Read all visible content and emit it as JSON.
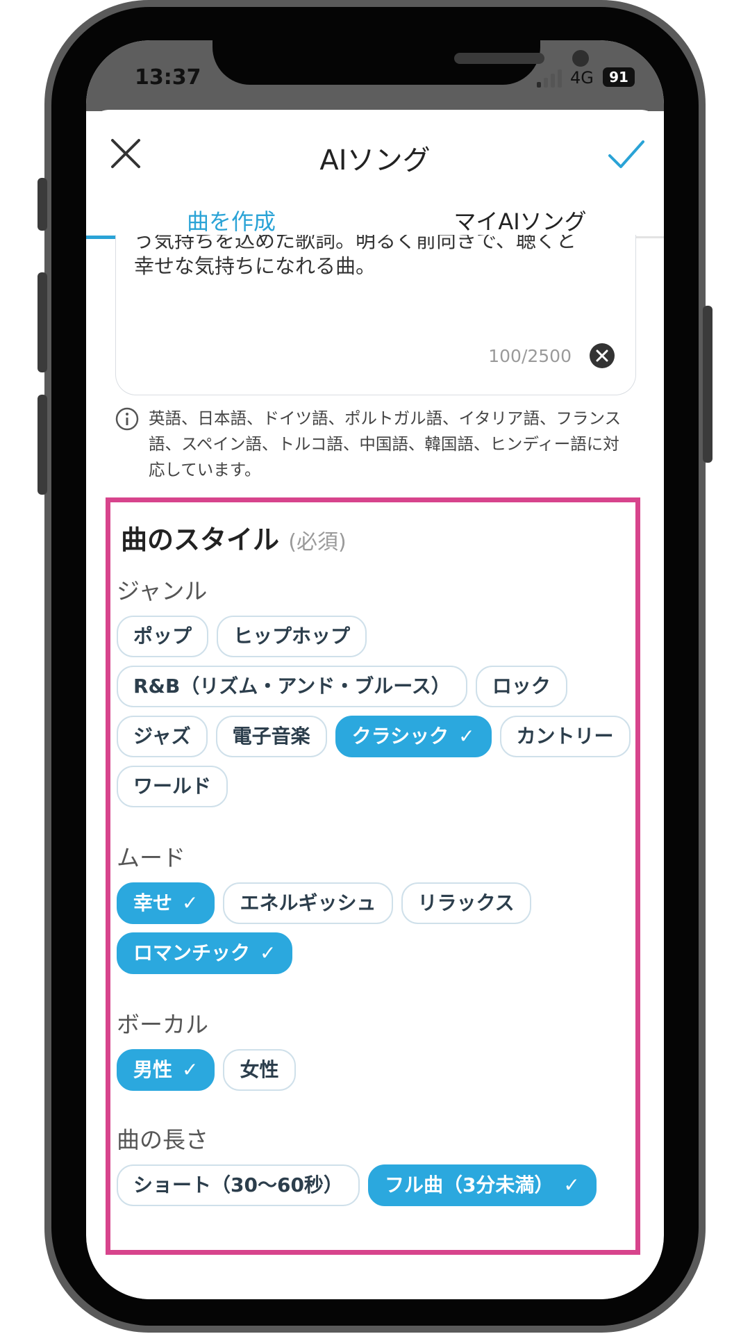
{
  "status": {
    "time": "13:37",
    "network": "4G",
    "battery": "91"
  },
  "header": {
    "title": "AIソング"
  },
  "tabs": [
    {
      "label": "曲を作成",
      "active": true
    },
    {
      "label": "マイAIソング",
      "active": false
    }
  ],
  "lyrics": {
    "text_line1": "う気持ちを込めた歌詞。明るく前向きで、聴くと",
    "text_line2": "幸せな気持ちになれる曲。",
    "counter": "100/2500"
  },
  "info": "英語、日本語、ドイツ語、ポルトガル語、イタリア語、フランス語、スペイン語、トルコ語、中国語、韓国語、ヒンディー語に対応しています。",
  "style": {
    "title": "曲のスタイル",
    "required": "(必須)",
    "genre": {
      "label": "ジャンル",
      "options": [
        {
          "label": "ポップ",
          "selected": false
        },
        {
          "label": "ヒップホップ",
          "selected": false
        },
        {
          "label": "R&B（リズム・アンド・ブルース）",
          "selected": false
        },
        {
          "label": "ロック",
          "selected": false
        },
        {
          "label": "ジャズ",
          "selected": false
        },
        {
          "label": "電子音楽",
          "selected": false
        },
        {
          "label": "クラシック",
          "selected": true
        },
        {
          "label": "カントリー",
          "selected": false
        },
        {
          "label": "ワールド",
          "selected": false
        }
      ]
    },
    "mood": {
      "label": "ムード",
      "options": [
        {
          "label": "幸せ",
          "selected": true
        },
        {
          "label": "エネルギッシュ",
          "selected": false
        },
        {
          "label": "リラックス",
          "selected": false
        },
        {
          "label": "ロマンチック",
          "selected": true
        }
      ]
    },
    "vocal": {
      "label": "ボーカル",
      "options": [
        {
          "label": "男性",
          "selected": true
        },
        {
          "label": "女性",
          "selected": false
        }
      ]
    },
    "length": {
      "label": "曲の長さ",
      "options": [
        {
          "label": "ショート（30〜60秒）",
          "selected": false
        },
        {
          "label": "フル曲（3分未満）",
          "selected": true
        }
      ]
    }
  },
  "colors": {
    "accent": "#2ba8de",
    "highlight_border": "#d7448c"
  },
  "icons": {
    "close": "close-icon",
    "done": "checkmark-icon",
    "clear": "clear-circle-icon",
    "info": "info-icon",
    "selected": "check-icon"
  }
}
